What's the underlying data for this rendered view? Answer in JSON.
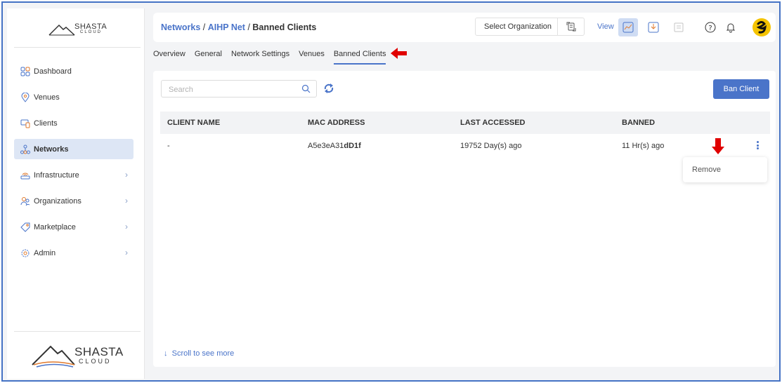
{
  "brand": {
    "top_name": "SHASTA",
    "top_sub": "CLOUD",
    "bottom_name": "SHASTA",
    "bottom_sub": "CLOUD"
  },
  "sidebar": {
    "items": [
      {
        "label": "Dashboard",
        "icon": "dashboard-icon",
        "chevron": false,
        "active": false
      },
      {
        "label": "Venues",
        "icon": "location-pin-icon",
        "chevron": false,
        "active": false
      },
      {
        "label": "Clients",
        "icon": "devices-icon",
        "chevron": false,
        "active": false
      },
      {
        "label": "Networks",
        "icon": "network-icon",
        "chevron": false,
        "active": true
      },
      {
        "label": "Infrastructure",
        "icon": "router-icon",
        "chevron": true,
        "active": false
      },
      {
        "label": "Organizations",
        "icon": "users-icon",
        "chevron": true,
        "active": false
      },
      {
        "label": "Marketplace",
        "icon": "tag-icon",
        "chevron": true,
        "active": false
      },
      {
        "label": "Admin",
        "icon": "gear-icon",
        "chevron": true,
        "active": false
      }
    ]
  },
  "header": {
    "breadcrumb": {
      "part1": "Networks",
      "sep1": " / ",
      "part2": "AIHP Net",
      "sep2": " / ",
      "current": "Banned Clients"
    },
    "org_select_label": "Select Organization",
    "view_label": "View"
  },
  "tabs": [
    "Overview",
    "General",
    "Network Settings",
    "Venues",
    "Banned Clients"
  ],
  "active_tab": "Banned Clients",
  "toolbar": {
    "search_placeholder": "Search",
    "ban_button": "Ban Client"
  },
  "table": {
    "columns": [
      "CLIENT NAME",
      "MAC ADDRESS",
      "LAST ACCESSED",
      "BANNED"
    ],
    "rows": [
      {
        "client_name": "-",
        "mac_prefix": "A5e3eA31",
        "mac_suffix": "dD1f",
        "last_accessed": "19752 Day(s) ago",
        "banned": "11 Hr(s) ago"
      }
    ]
  },
  "row_menu": {
    "remove_label": "Remove"
  },
  "footer": {
    "scroll_hint": "Scroll to see more"
  },
  "colors": {
    "accent": "#4a74c9",
    "annotation_arrow": "#e00000",
    "frame_border": "#4472c4"
  }
}
